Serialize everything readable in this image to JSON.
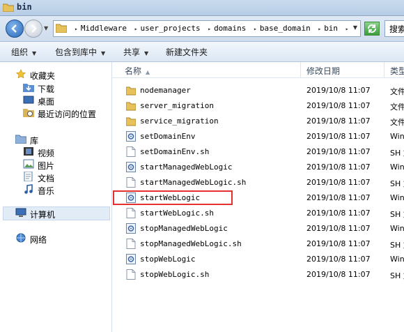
{
  "window": {
    "title": "bin"
  },
  "address": {
    "crumbs": [
      "Middleware",
      "user_projects",
      "domains",
      "base_domain",
      "bin"
    ],
    "search_placeholder": "搜索"
  },
  "toolbar": {
    "organize": "组织",
    "include_in_library": "包含到库中",
    "share": "共享",
    "new_folder": "新建文件夹"
  },
  "sidebar": {
    "favorites": {
      "label": "收藏夹",
      "items": [
        "下载",
        "桌面",
        "最近访问的位置"
      ]
    },
    "libraries": {
      "label": "库",
      "items": [
        "视频",
        "图片",
        "文档",
        "音乐"
      ]
    },
    "computer": "计算机",
    "network": "网络"
  },
  "columns": {
    "name": "名称",
    "modified": "修改日期",
    "type": "类型"
  },
  "files": [
    {
      "name": "nodemanager",
      "date": "2019/10/8 11:07",
      "type": "文件",
      "icon": "folder-icon"
    },
    {
      "name": "server_migration",
      "date": "2019/10/8 11:07",
      "type": "文件",
      "icon": "folder-icon"
    },
    {
      "name": "service_migration",
      "date": "2019/10/8 11:07",
      "type": "文件",
      "icon": "folder-icon"
    },
    {
      "name": "setDomainEnv",
      "date": "2019/10/8 11:07",
      "type": "Win",
      "icon": "batch-file-icon"
    },
    {
      "name": "setDomainEnv.sh",
      "date": "2019/10/8 11:07",
      "type": "SH 文",
      "icon": "document-icon"
    },
    {
      "name": "startManagedWebLogic",
      "date": "2019/10/8 11:07",
      "type": "Win",
      "icon": "batch-file-icon"
    },
    {
      "name": "startManagedWebLogic.sh",
      "date": "2019/10/8 11:07",
      "type": "SH 文",
      "icon": "document-icon"
    },
    {
      "name": "startWebLogic",
      "date": "2019/10/8 11:07",
      "type": "Win",
      "icon": "batch-file-icon"
    },
    {
      "name": "startWebLogic.sh",
      "date": "2019/10/8 11:07",
      "type": "SH 文",
      "icon": "document-icon"
    },
    {
      "name": "stopManagedWebLogic",
      "date": "2019/10/8 11:07",
      "type": "Win",
      "icon": "batch-file-icon"
    },
    {
      "name": "stopManagedWebLogic.sh",
      "date": "2019/10/8 11:07",
      "type": "SH 文",
      "icon": "document-icon"
    },
    {
      "name": "stopWebLogic",
      "date": "2019/10/8 11:07",
      "type": "Win",
      "icon": "batch-file-icon"
    },
    {
      "name": "stopWebLogic.sh",
      "date": "2019/10/8 11:07",
      "type": "SH 文",
      "icon": "document-icon"
    }
  ],
  "highlighted_file": "startWebLogic",
  "colors": {
    "highlight_border": "#e53030",
    "selected_nav": "#e2ecf7"
  }
}
